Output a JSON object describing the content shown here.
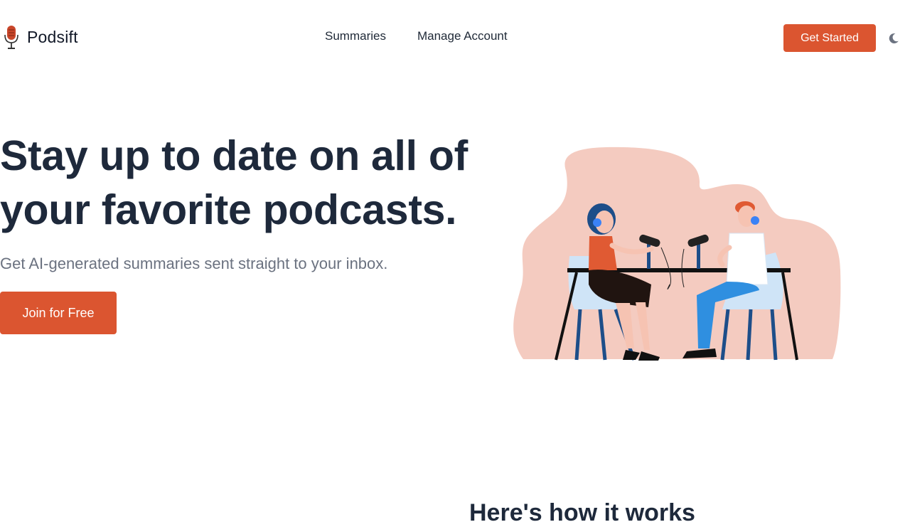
{
  "header": {
    "brand": "Podsift",
    "logo_icon": "microphone-icon",
    "nav": [
      "Summaries",
      "Manage Account"
    ],
    "cta_label": "Get Started",
    "theme_icon": "moon-icon"
  },
  "hero": {
    "title": "Stay up to date on all of your favorite podcasts.",
    "subtitle": "Get AI-generated summaries sent straight to your inbox.",
    "button_label": "Join for Free",
    "illustration": "podcast-hosts-illustration"
  },
  "how": {
    "title": "Here's how it works"
  },
  "colors": {
    "accent": "#db5530",
    "blob": "#f4cbc0",
    "heading": "#1e293b",
    "muted": "#6b7280"
  }
}
